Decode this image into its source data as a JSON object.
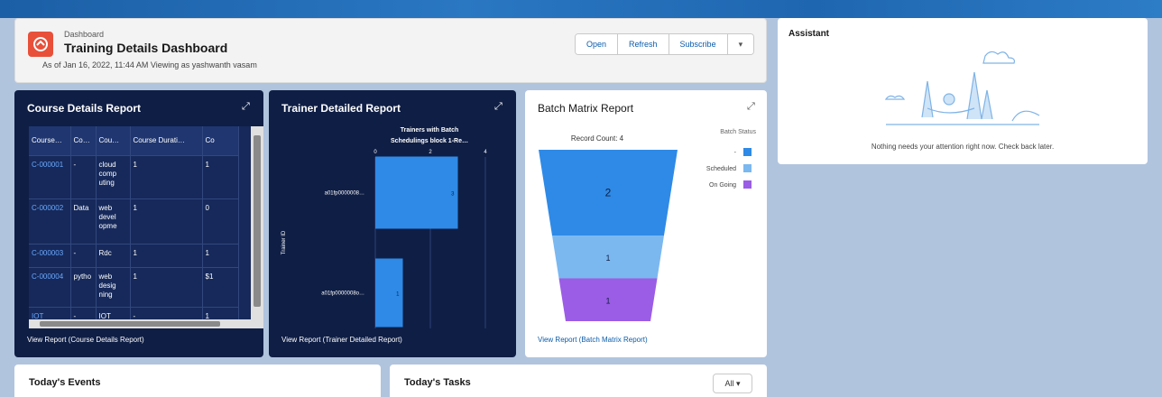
{
  "header": {
    "eyebrow": "Dashboard",
    "title": "Training Details Dashboard",
    "subtitle": "As of Jan 16, 2022, 11:44 AM Viewing as yashwanth vasam",
    "buttons": {
      "open": "Open",
      "refresh": "Refresh",
      "subscribe": "Subscribe",
      "more": "▾"
    }
  },
  "assistant": {
    "title": "Assistant",
    "message": "Nothing needs your attention right now. Check back later."
  },
  "course_report": {
    "title": "Course Details Report",
    "columns": [
      "Course…",
      "Co…",
      "Cou…",
      "Course Durati…",
      "Co"
    ],
    "rows": [
      [
        "C-000001",
        "-",
        "cloud comp uting",
        "1",
        "1"
      ],
      [
        "C-000002",
        "Data",
        "web devel opme",
        "1",
        "0"
      ],
      [
        "C-000003",
        "-",
        "Rdc",
        "1",
        "1"
      ],
      [
        "C-000004",
        "pytho",
        "web desig ning",
        "1",
        "$1"
      ],
      [
        "IOT",
        "-",
        "IOT",
        "-",
        "1"
      ]
    ],
    "view_link": "View Report (Course Details Report)"
  },
  "trainer_report": {
    "title": "Trainer Detailed Report",
    "view_link": "View Report (Trainer Detailed Report)"
  },
  "batch_report": {
    "title": "Batch Matrix Report",
    "view_link": "View Report (Batch Matrix Report)"
  },
  "chart_data": [
    {
      "type": "bar",
      "orientation": "horizontal",
      "title": "Trainers with Batch Schedulings block 1-Re…",
      "ylabel": "Trainer ID",
      "xlabel": "",
      "xticks": [
        "0",
        "2",
        "4"
      ],
      "xlim": [
        0,
        4
      ],
      "categories": [
        "a01fp0000008…",
        "a01fp0000008o…"
      ],
      "values": [
        3,
        1
      ]
    },
    {
      "type": "funnel",
      "title": "Record Count: 4",
      "legend_title": "Batch Status",
      "legend_position": "right",
      "categories": [
        "-",
        "Scheduled",
        "On Going"
      ],
      "values": [
        2,
        1,
        1
      ],
      "colors": [
        "#2e8ae6",
        "#7bb8f0",
        "#9b5de5"
      ]
    }
  ],
  "bottom": {
    "events_title": "Today's Events",
    "tasks_title": "Today's Tasks",
    "tasks_filter": "All ▾"
  }
}
